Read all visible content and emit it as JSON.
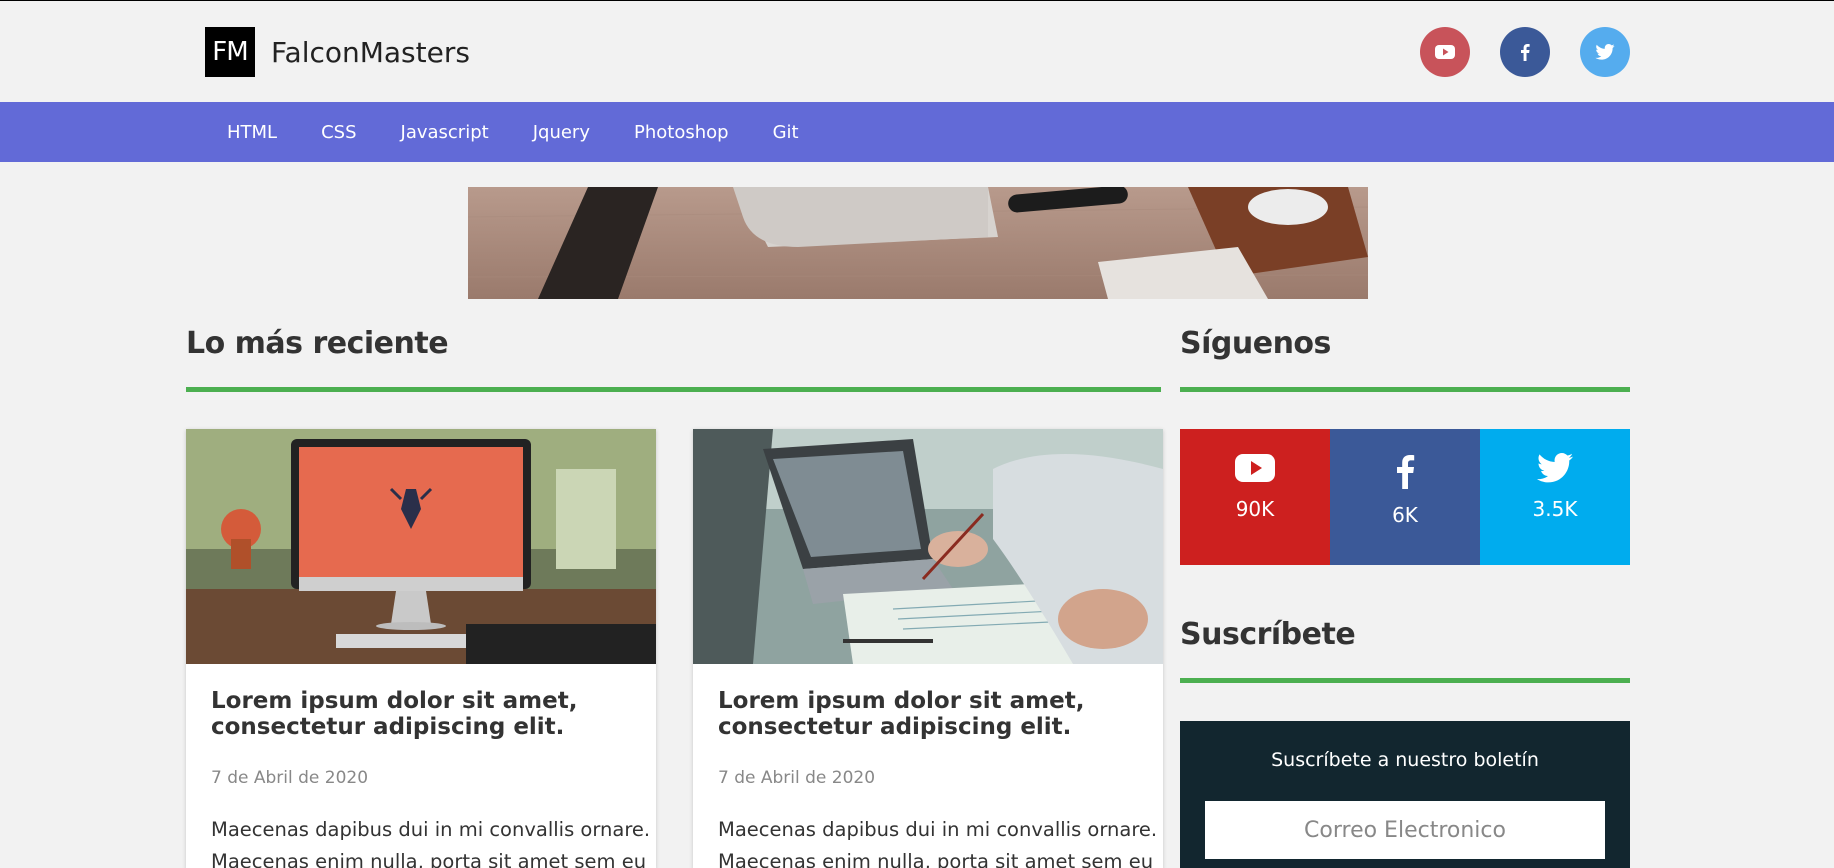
{
  "brand": {
    "mark": "FM",
    "name": "FalconMasters"
  },
  "header_social": [
    {
      "name": "youtube-icon",
      "color": "#c8535a"
    },
    {
      "name": "facebook-icon",
      "color": "#3b5998"
    },
    {
      "name": "twitter-icon",
      "color": "#55acee"
    }
  ],
  "nav": {
    "items": [
      "HTML",
      "CSS",
      "Javascript",
      "Jquery",
      "Photoshop",
      "Git"
    ]
  },
  "latest": {
    "heading": "Lo más reciente",
    "posts": [
      {
        "title": "Lorem ipsum dolor sit amet, consectetur adipiscing elit.",
        "date": "7 de Abril de 2020",
        "excerpt": "Maecenas dapibus dui in mi convallis ornare. Maecenas enim nulla, porta sit amet sem eu"
      },
      {
        "title": "Lorem ipsum dolor sit amet, consectetur adipiscing elit.",
        "date": "7 de Abril de 2020",
        "excerpt": "Maecenas dapibus dui in mi convallis ornare. Maecenas enim nulla, porta sit amet sem eu"
      }
    ]
  },
  "follow": {
    "heading": "Síguenos",
    "items": [
      {
        "icon": "youtube-icon",
        "count": "90K",
        "color": "#cd201f"
      },
      {
        "icon": "facebook-icon",
        "count": "6K",
        "color": "#3b5998"
      },
      {
        "icon": "twitter-icon",
        "count": "3.5K",
        "color": "#00acee"
      }
    ]
  },
  "subscribe": {
    "heading": "Suscríbete",
    "text": "Suscríbete a nuestro boletín",
    "placeholder": "Correo Electronico"
  },
  "colors": {
    "nav": "#626ad7",
    "accent_line": "#4caf50",
    "subscribe_bg": "#12262f"
  }
}
